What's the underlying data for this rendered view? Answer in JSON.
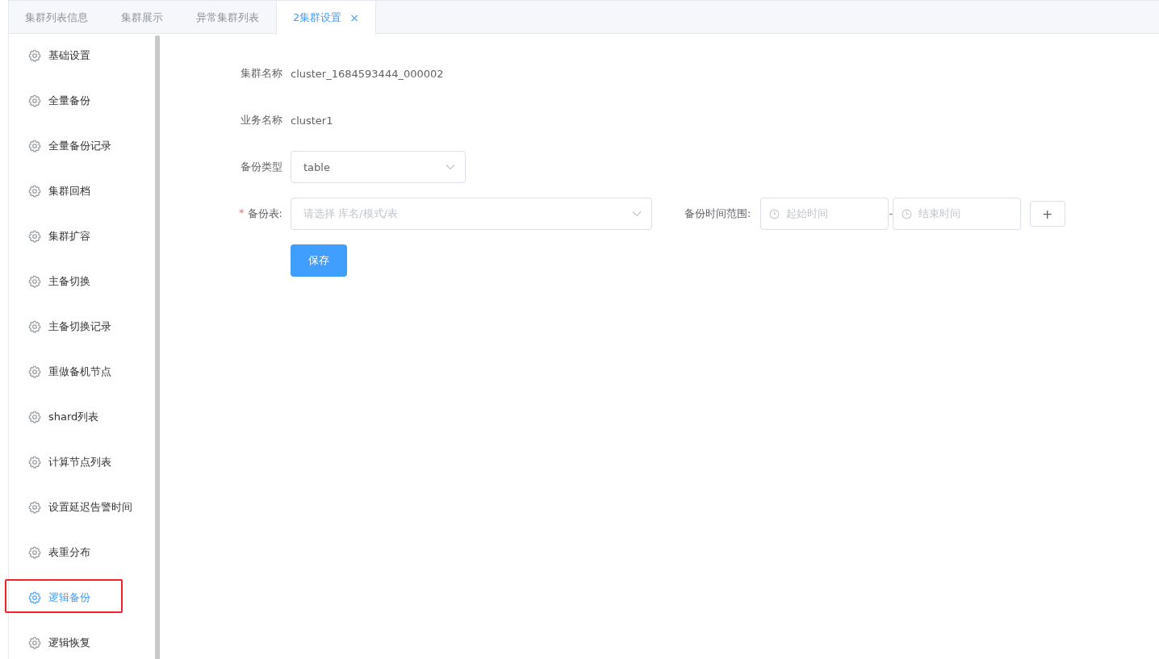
{
  "tabs": [
    {
      "label": "集群列表信息",
      "selected": false,
      "closable": false
    },
    {
      "label": "集群展示",
      "selected": false,
      "closable": false
    },
    {
      "label": "异常集群列表",
      "selected": false,
      "closable": false
    },
    {
      "label": "2集群设置",
      "selected": true,
      "closable": true,
      "close_glyph": "×"
    }
  ],
  "sidebar": {
    "items": [
      {
        "label": "基础设置",
        "selected": false,
        "annotated": false
      },
      {
        "label": "全量备份",
        "selected": false,
        "annotated": false
      },
      {
        "label": "全量备份记录",
        "selected": false,
        "annotated": false
      },
      {
        "label": "集群回档",
        "selected": false,
        "annotated": false
      },
      {
        "label": "集群扩容",
        "selected": false,
        "annotated": false
      },
      {
        "label": "主备切换",
        "selected": false,
        "annotated": false
      },
      {
        "label": "主备切换记录",
        "selected": false,
        "annotated": false
      },
      {
        "label": "重做备机节点",
        "selected": false,
        "annotated": false
      },
      {
        "label": "shard列表",
        "selected": false,
        "annotated": false
      },
      {
        "label": "计算节点列表",
        "selected": false,
        "annotated": false
      },
      {
        "label": "设置延迟告警时间",
        "selected": false,
        "annotated": false
      },
      {
        "label": "表重分布",
        "selected": false,
        "annotated": false
      },
      {
        "label": "逻辑备份",
        "selected": true,
        "annotated": true
      },
      {
        "label": "逻辑恢复",
        "selected": false,
        "annotated": false
      }
    ]
  },
  "form": {
    "cluster_name": {
      "label": "集群名称",
      "value": "cluster_1684593444_000002"
    },
    "business_name": {
      "label": "业务名称",
      "value": "cluster1"
    },
    "backup_type": {
      "label": "备份类型",
      "value": "table"
    },
    "backup_table": {
      "label": "备份表:",
      "required": true,
      "required_mark": "*",
      "placeholder": "请选择 库名/模式/表"
    },
    "time_range": {
      "label": "备份时间范围:",
      "start_placeholder": "起始时间",
      "separator": "-",
      "end_placeholder": "结束时间",
      "add_glyph": "+"
    },
    "save_button": "保存"
  }
}
